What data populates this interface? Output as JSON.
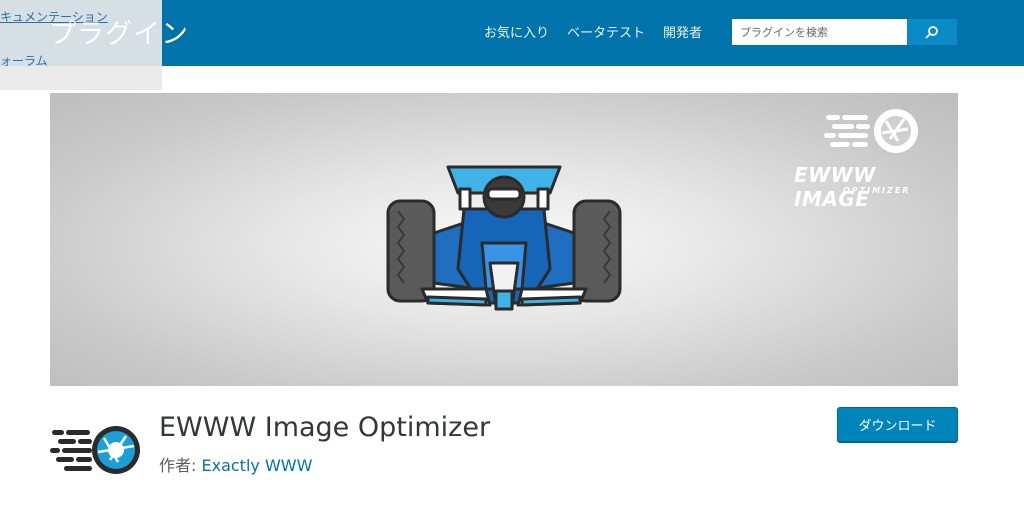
{
  "header": {
    "title": "プラグイン",
    "nav": [
      "お気に入り",
      "ベータテスト",
      "開発者"
    ],
    "search_placeholder": "プラグインを検索"
  },
  "side_menu": {
    "items": [
      "キュメンテーション",
      "ォーラム"
    ]
  },
  "banner": {
    "logo_line1": "EWWW IMAGE",
    "logo_line2": "OPTIMIZER"
  },
  "plugin": {
    "name": "EWWW Image Optimizer",
    "author_prefix": "作者: ",
    "author_name": "Exactly WWW",
    "download_label": "ダウンロード"
  },
  "colors": {
    "header_bg": "#0073aa",
    "accent": "#0085ba",
    "link": "#0073aa",
    "logo_blue": "#1a9fd6"
  },
  "icons": [
    "search-icon",
    "ewww-logo-icon",
    "race-car-illustration"
  ]
}
